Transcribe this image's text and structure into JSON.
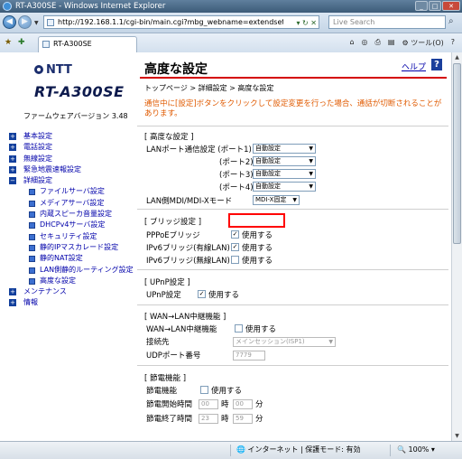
{
  "window": {
    "title": "RT-A300SE - Windows Internet Explorer"
  },
  "browser": {
    "url": "http://192.168.1.1/cgi-bin/main.cgi?mbg_webname=extendsetting&confi",
    "search_placeholder": "Live Search",
    "tab_title": "RT-A300SE",
    "tools_label": "ツール(O)",
    "status_zone": "インターネット | 保護モード: 有効",
    "zoom": "100%"
  },
  "page": {
    "brand": "NTT",
    "model": "RT-A300SE",
    "firmware": "ファームウェアバージョン 3.48",
    "title": "高度な設定",
    "help": "ヘルプ",
    "help_icon": "?",
    "breadcrumb": "トップページ > 詳細設定 > 高度な設定",
    "warning": "通信中に[設定]ボタンをクリックして設定変更を行った場合、通話が切断されることがあります。"
  },
  "menu": [
    {
      "icon": "+",
      "label": "基本設定"
    },
    {
      "icon": "+",
      "label": "電話設定"
    },
    {
      "icon": "+",
      "label": "無線設定"
    },
    {
      "icon": "+",
      "label": "緊急地震速報設定"
    },
    {
      "icon": "−",
      "label": "詳細設定"
    }
  ],
  "submenu": [
    "ファイルサーバ設定",
    "メディアサーバ設定",
    "内蔵スピーカ音量設定",
    "DHCPv4サーバ設定",
    "セキュリティ設定",
    "静的IPマスカレード設定",
    "静的NAT設定",
    "LAN側静的ルーティング設定",
    "高度な設定"
  ],
  "menu_tail": [
    {
      "icon": "+",
      "label": "メンテナンス"
    },
    {
      "icon": "+",
      "label": "情報"
    }
  ],
  "advanced": {
    "header": "[ 高度な設定 ]",
    "lan1": "LANポート通信設定 (ポート1)",
    "lan2": "(ポート2)",
    "lan3": "(ポート3)",
    "lan4": "(ポート4)",
    "auto": "自動設定",
    "mdi_label": "LAN側MDI/MDI-Xモード",
    "mdi_value": "MDI-X固定"
  },
  "bridge": {
    "header": "[ ブリッジ設定 ]",
    "pppoe": "PPPoEブリッジ",
    "ipv6_wired": "IPv6ブリッジ(有線LAN)",
    "ipv6_wireless": "IPv6ブリッジ(無線LAN)",
    "use": "使用する",
    "check": "✓"
  },
  "upnp": {
    "header": "[ UPnP設定 ]",
    "label": "UPnP設定",
    "use": "使用する",
    "check": "✓"
  },
  "wan": {
    "header": "[ WAN→LAN中継機能 ]",
    "func": "WAN→LAN中継機能",
    "use": "使用する",
    "dest": "接続先",
    "dest_value": "メインセッション(ISP1)",
    "udp": "UDPポート番号",
    "udp_value": "7779"
  },
  "power": {
    "header": "[ 節電機能 ]",
    "func": "節電機能",
    "use": "使用する",
    "start": "節電開始時間",
    "end": "節電終了時間",
    "h": "時",
    "m": "分",
    "start_h": "00",
    "start_m": "00",
    "end_h": "23",
    "end_m": "59"
  }
}
